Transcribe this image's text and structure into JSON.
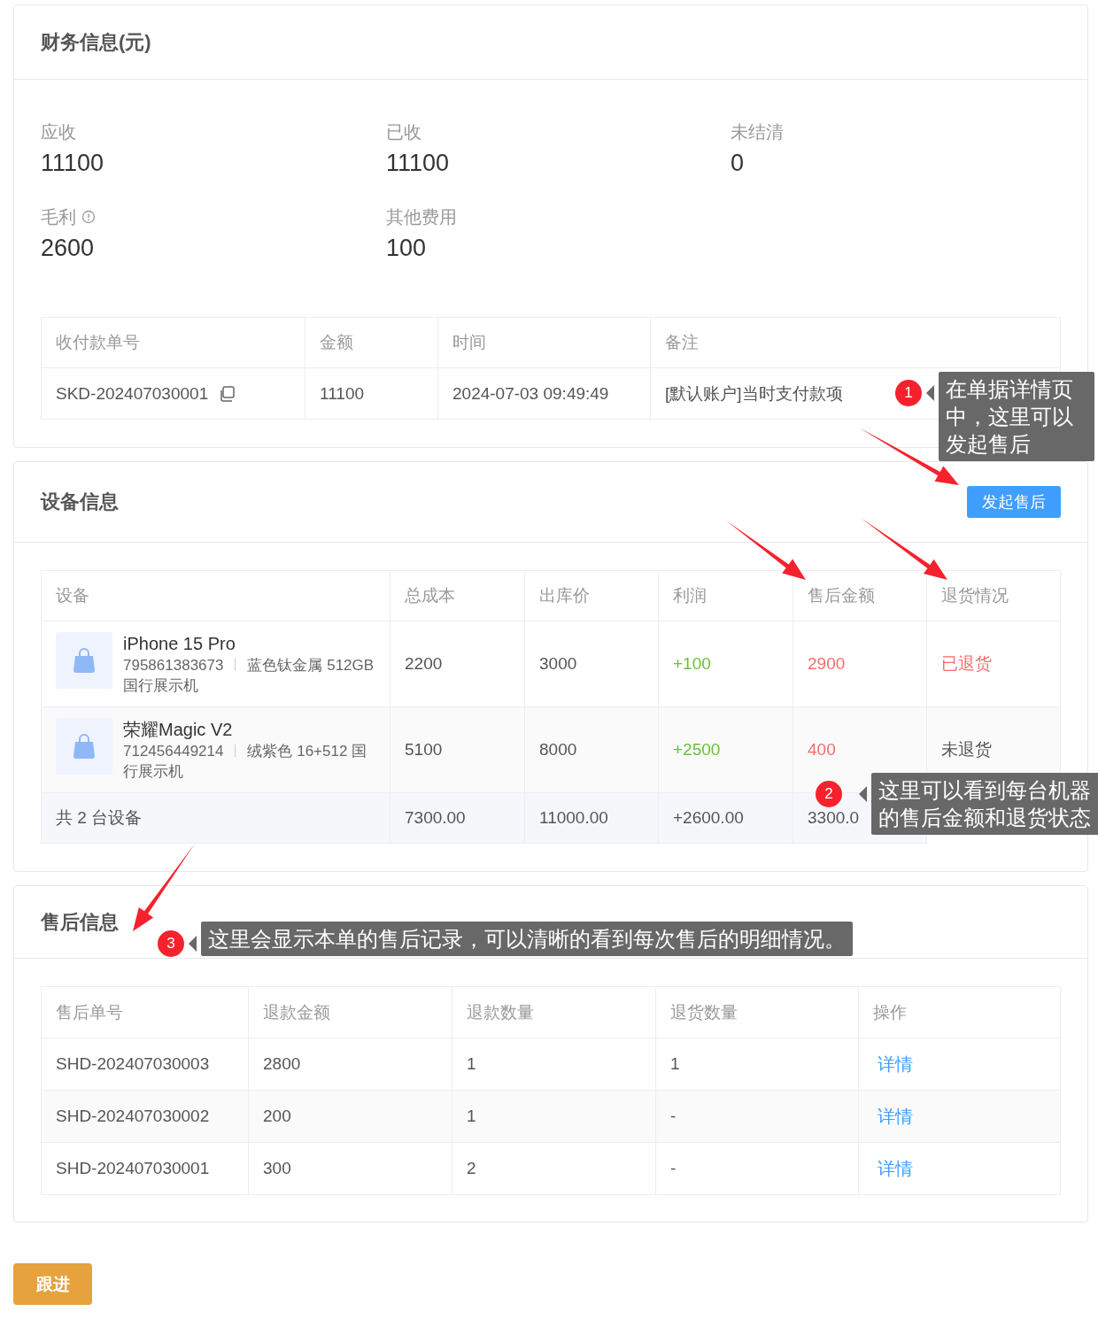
{
  "finance": {
    "title": "财务信息(元)",
    "stats": [
      {
        "label": "应收",
        "value": "11100",
        "info": false
      },
      {
        "label": "已收",
        "value": "11100",
        "info": false
      },
      {
        "label": "未结清",
        "value": "0",
        "info": false
      },
      {
        "label": "毛利",
        "value": "2600",
        "info": true
      },
      {
        "label": "其他费用",
        "value": "100",
        "info": false
      }
    ],
    "columns": [
      "收付款单号",
      "金额",
      "时间",
      "备注"
    ],
    "rows": [
      {
        "number": "SKD-202407030001",
        "amount": "11100",
        "time": "2024-07-03 09:49:49",
        "note": "[默认账户]当时支付款项"
      }
    ]
  },
  "devices": {
    "title": "设备信息",
    "action": "发起售后",
    "columns": [
      "设备",
      "总成本",
      "出库价",
      "利润",
      "售后金额",
      "退货情况"
    ],
    "rows": [
      {
        "name": "iPhone 15 Pro",
        "serial": "795861383673",
        "spec": "蓝色钛金属 512GB 国行展示机",
        "cost": "2200",
        "price": "3000",
        "profit": "+100",
        "aftersale": "2900",
        "status": "已退货",
        "returned": true
      },
      {
        "name": "荣耀Magic V2",
        "serial": "712456449214",
        "spec": "绒紫色 16+512 国行展示机",
        "cost": "5100",
        "price": "8000",
        "profit": "+2500",
        "aftersale": "400",
        "status": "未退货",
        "returned": false
      }
    ],
    "summary": [
      "共 2 台设备",
      "7300.00",
      "11000.00",
      "+2600.00",
      "3300.0"
    ]
  },
  "aftersales": {
    "title": "售后信息",
    "columns": [
      "售后单号",
      "退款金额",
      "退款数量",
      "退货数量",
      "操作"
    ],
    "rows": [
      {
        "number": "SHD-202407030003",
        "refund": "2800",
        "refund_qty": "1",
        "return_qty": "1",
        "action": "详情"
      },
      {
        "number": "SHD-202407030002",
        "refund": "200",
        "refund_qty": "1",
        "return_qty": "-",
        "action": "详情"
      },
      {
        "number": "SHD-202407030001",
        "refund": "300",
        "refund_qty": "2",
        "return_qty": "-",
        "action": "详情"
      }
    ]
  },
  "follow_button": "跟进",
  "annotations": [
    {
      "number": "1",
      "text": "在单据详情页中，这里可以发起售后"
    },
    {
      "number": "2",
      "text": "这里可以看到每台机器的售后金额和退货状态"
    },
    {
      "number": "3",
      "text": "这里会显示本单的售后记录，可以清晰的看到每次售后的明细情况。"
    }
  ]
}
